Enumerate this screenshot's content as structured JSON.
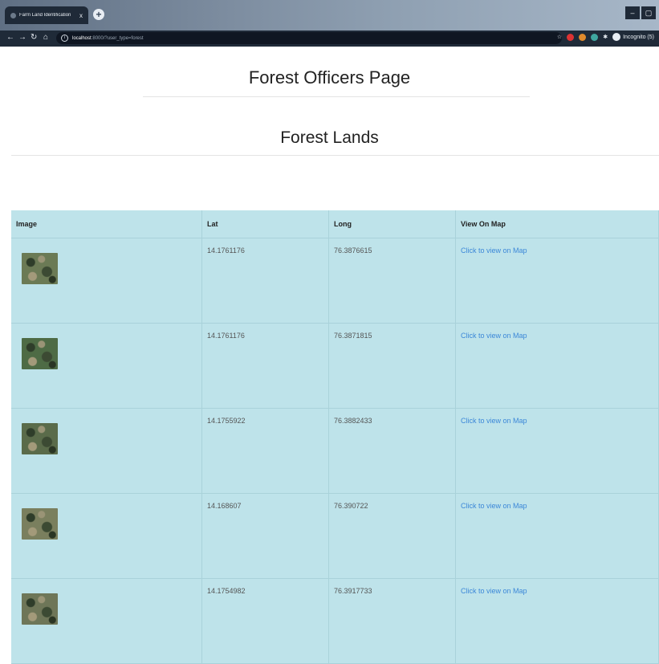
{
  "browser": {
    "tab_title": "Farm Land Identification",
    "tab_close": "x",
    "new_tab": "+",
    "url_host": "localhost",
    "url_path": ":8000/?user_type=forest",
    "incognito_label": "Incognito (5)",
    "window_controls": [
      "–",
      "▢"
    ]
  },
  "page": {
    "title": "Forest Officers Page",
    "section_title": "Forest Lands"
  },
  "table": {
    "headers": [
      "Image",
      "Lat",
      "Long",
      "View On Map"
    ],
    "rows": [
      {
        "lat": "14.1761176",
        "long": "76.3876615",
        "link": "Click to view on Map",
        "tone": "#6b7a55"
      },
      {
        "lat": "14.1761176",
        "long": "76.3871815",
        "link": "Click to view on Map",
        "tone": "#4e6b45"
      },
      {
        "lat": "14.1755922",
        "long": "76.3882433",
        "link": "Click to view on Map",
        "tone": "#5a6b4a"
      },
      {
        "lat": "14.168607",
        "long": "76.390722",
        "link": "Click to view on Map",
        "tone": "#7a7f5e"
      },
      {
        "lat": "14.1754982",
        "long": "76.3917733",
        "link": "Click to view on Map",
        "tone": "#6e7658"
      }
    ]
  }
}
